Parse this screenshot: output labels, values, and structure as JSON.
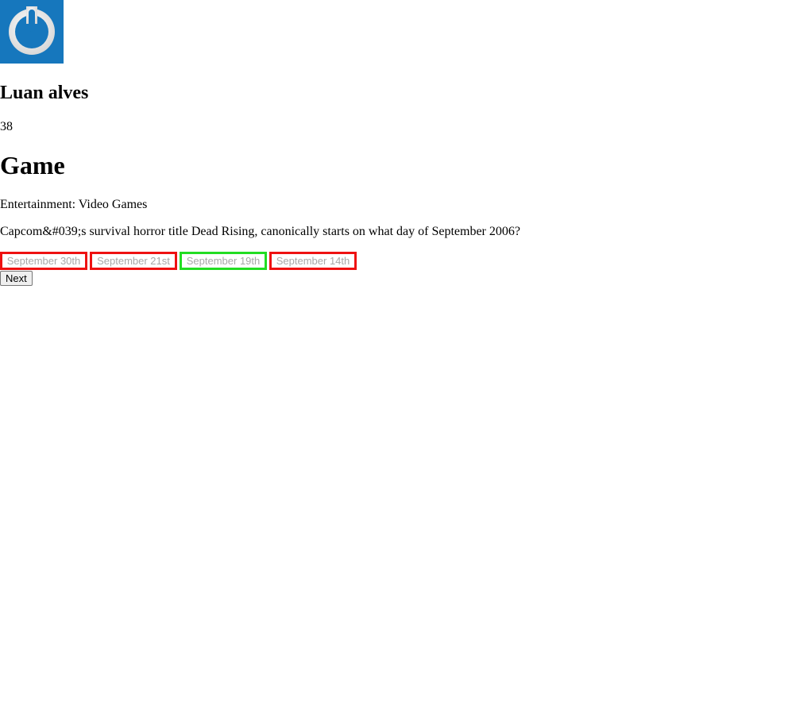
{
  "player": {
    "avatar_icon": "power-icon",
    "avatar_color": "#1677bd",
    "name": "Luan alves",
    "score": "38"
  },
  "game": {
    "title": "Game",
    "category": "Entertainment: Video Games",
    "question": "Capcom&#039;s survival horror title Dead Rising, canonically starts on what day of September 2006?",
    "answers": [
      {
        "label": "September 30th",
        "status": "incorrect"
      },
      {
        "label": "September 21st",
        "status": "incorrect"
      },
      {
        "label": "September 19th",
        "status": "correct"
      },
      {
        "label": "September 14th",
        "status": "incorrect"
      }
    ],
    "next_label": "Next"
  },
  "colors": {
    "correct": "#22dd22",
    "incorrect": "#ee1111"
  }
}
